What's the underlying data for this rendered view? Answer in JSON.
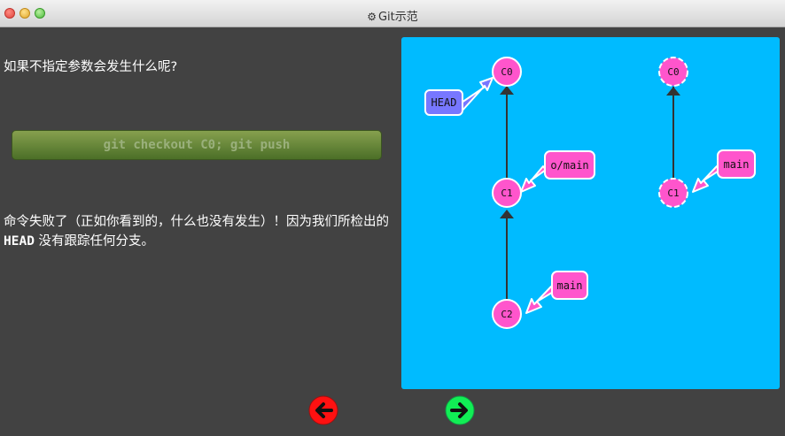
{
  "window": {
    "title": "Git示范",
    "icon": "gear-icon"
  },
  "lesson": {
    "intro_text": "如果不指定参数会发生什么呢?",
    "command": "git checkout C0; git push",
    "outro_before": "命令失败了（正如你看到的，什么也没有发生）！因为我们所检出的 ",
    "outro_code": "HEAD",
    "outro_after": " 没有跟踪任何分支。"
  },
  "visualization": {
    "background_color": "#00bbff",
    "local_repo": {
      "commits": [
        "C0",
        "C1",
        "C2"
      ],
      "branches": [
        {
          "name": "o/main",
          "target": "C1"
        },
        {
          "name": "main",
          "target": "C2"
        }
      ],
      "head": {
        "label": "HEAD",
        "target": "C0"
      }
    },
    "remote_repo": {
      "commits": [
        "C0",
        "C1"
      ],
      "branches": [
        {
          "name": "main",
          "target": "C1"
        }
      ]
    },
    "colors": {
      "commit": "#ff55cc",
      "branch_label": "#ff55cc",
      "head": "#7777ff",
      "edge": "#333333"
    }
  },
  "navigation": {
    "back_icon": "arrow-left-icon",
    "forward_icon": "arrow-right-icon",
    "back_color": "#ff1111",
    "forward_color": "#11ee55"
  }
}
